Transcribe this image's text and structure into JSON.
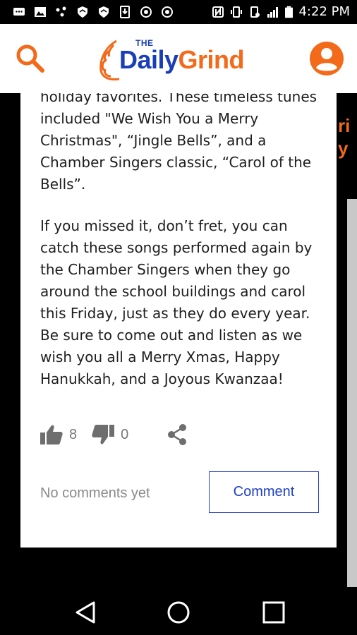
{
  "status_bar": {
    "time": "4:22 PM",
    "icons": [
      "message-icon",
      "image-icon",
      "tethering-icon",
      "vpn-shield-icon",
      "vpn-shield-icon",
      "download-icon",
      "sync-icon",
      "sync-icon",
      "nfc-icon",
      "vibrate-icon",
      "battery-saver-icon",
      "signal-icon",
      "battery-icon"
    ]
  },
  "header": {
    "logo_the": "THE",
    "logo_daily": "Daily",
    "logo_grind": "Grind",
    "brand_blue": "#1a3db8",
    "brand_orange": "#f26a1a"
  },
  "article": {
    "paragraph1": "holiday favorites. These timeless tunes included \"We Wish You a Merry Christmas\", “Jingle Bells”, and a Chamber Singers classic, “Carol of the Bells”.",
    "paragraph2": "If you missed it, don’t fret, you can catch these songs performed again by the Chamber Singers when they go around the school buildings and carol this Friday, just as they do every year. Be sure to come out and listen as we wish you all a Merry Xmas, Happy Hanukkah, and a Joyous Kwanzaa!"
  },
  "actions": {
    "likes": "8",
    "dislikes": "0"
  },
  "comments": {
    "empty_text": "No comments yet",
    "button_label": "Comment"
  },
  "side_peek": {
    "line1": "ri",
    "line2": "y"
  }
}
